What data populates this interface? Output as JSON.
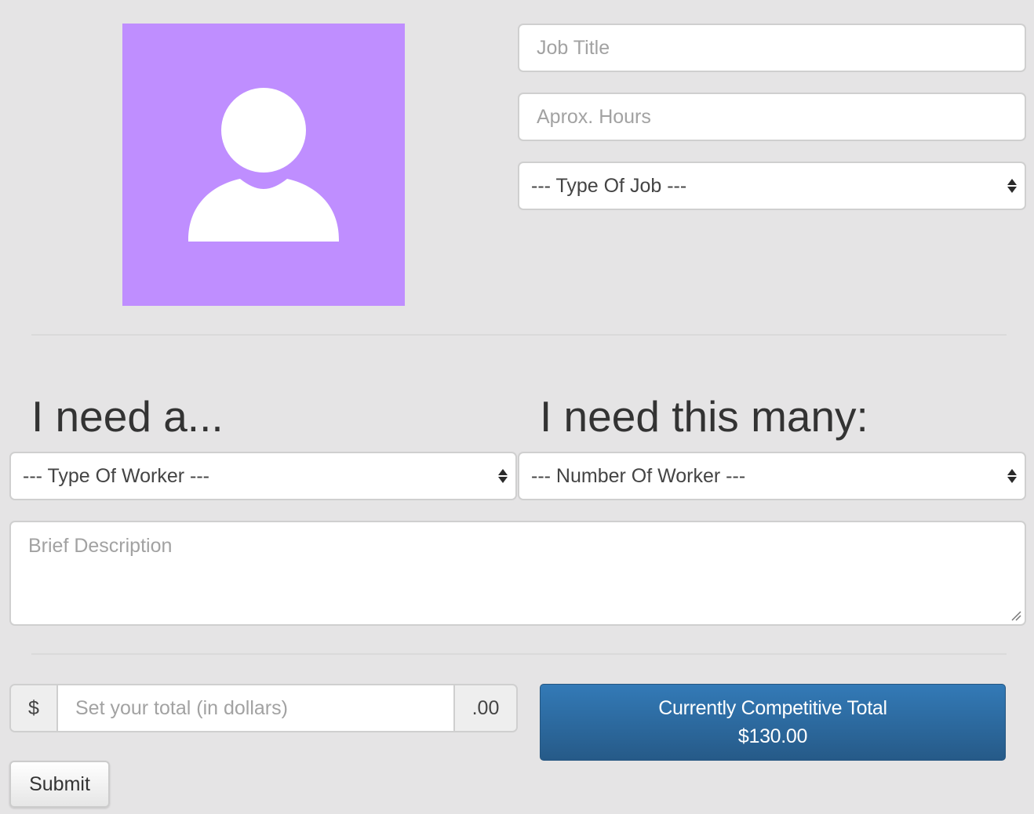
{
  "profile": {
    "avatar_icon": "user-silhouette-icon",
    "avatar_color": "#bf8eff"
  },
  "job": {
    "title_placeholder": "Job Title",
    "hours_placeholder": "Aprox. Hours",
    "type_selected": "--- Type Of Job ---"
  },
  "workers": {
    "heading_type": "I need a...",
    "heading_count": "I need this many:",
    "type_selected": "--- Type Of Worker ---",
    "count_selected": "--- Number Of Worker ---"
  },
  "description": {
    "placeholder": "Brief Description"
  },
  "pricing": {
    "currency_symbol": "$",
    "amount_placeholder": "Set your total (in dollars)",
    "cents_suffix": ".00",
    "competitive_label": "Currently Competitive Total",
    "competitive_value": "$130.00",
    "accent_color": "#337ab7"
  },
  "actions": {
    "submit_label": "Submit"
  }
}
